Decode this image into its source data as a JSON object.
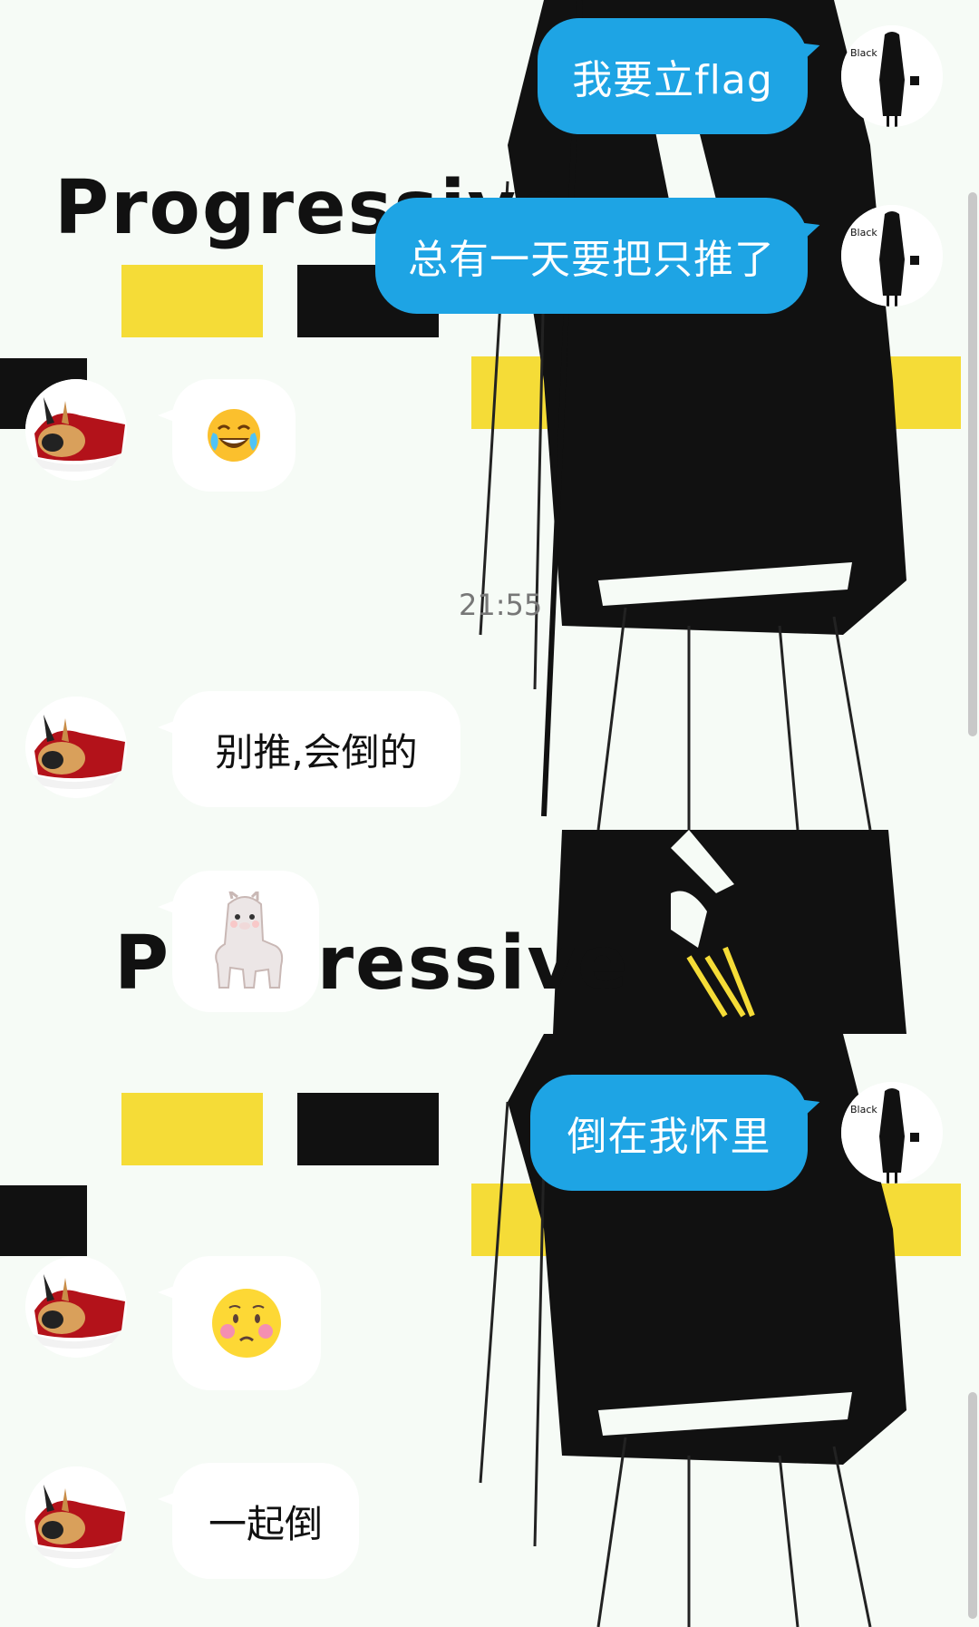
{
  "top": {
    "background": {
      "logo_text": "Progressive"
    },
    "messages": [
      {
        "side": "out",
        "text": "我要立flag"
      },
      {
        "side": "out",
        "text": "总有一天要把只推了"
      },
      {
        "side": "in",
        "emoji": "face-with-tears-of-joy-icon"
      },
      {
        "side": "time",
        "text": "21:55"
      },
      {
        "side": "in",
        "text": "别推,会倒的"
      },
      {
        "side": "in",
        "emoji": "alpaca-sticker-icon"
      }
    ]
  },
  "bottom": {
    "background": {
      "logo_text": "Progressive"
    },
    "messages": [
      {
        "side": "out",
        "text": "倒在我怀里"
      },
      {
        "side": "in",
        "emoji": "blushing-face-icon"
      },
      {
        "side": "in",
        "text": "一起倒"
      }
    ]
  },
  "avatars": {
    "self_label": "Black",
    "self_icon": "girl-avatar-icon",
    "other_icon": "rabbit-avatar-icon"
  },
  "colors": {
    "outgoing_bubble": "#1ea4e4",
    "incoming_bubble": "#ffffff",
    "accent_yellow": "#f5dc37"
  }
}
